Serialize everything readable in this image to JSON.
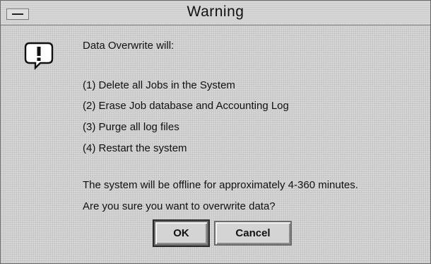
{
  "window": {
    "title": "Warning"
  },
  "message": {
    "intro": "Data Overwrite will:",
    "items": [
      "(1) Delete all Jobs in the System",
      "(2) Erase Job database and Accounting Log",
      "(3) Purge all log files",
      "(4) Restart the system"
    ],
    "offline_note": "The system will be offline for approximately 4-360 minutes.",
    "question": "Are you sure you want to overwrite data?"
  },
  "buttons": {
    "ok": "OK",
    "cancel": "Cancel"
  },
  "icons": {
    "system_menu": "system-menu-icon",
    "warning": "exclamation-speech-bubble-icon"
  }
}
